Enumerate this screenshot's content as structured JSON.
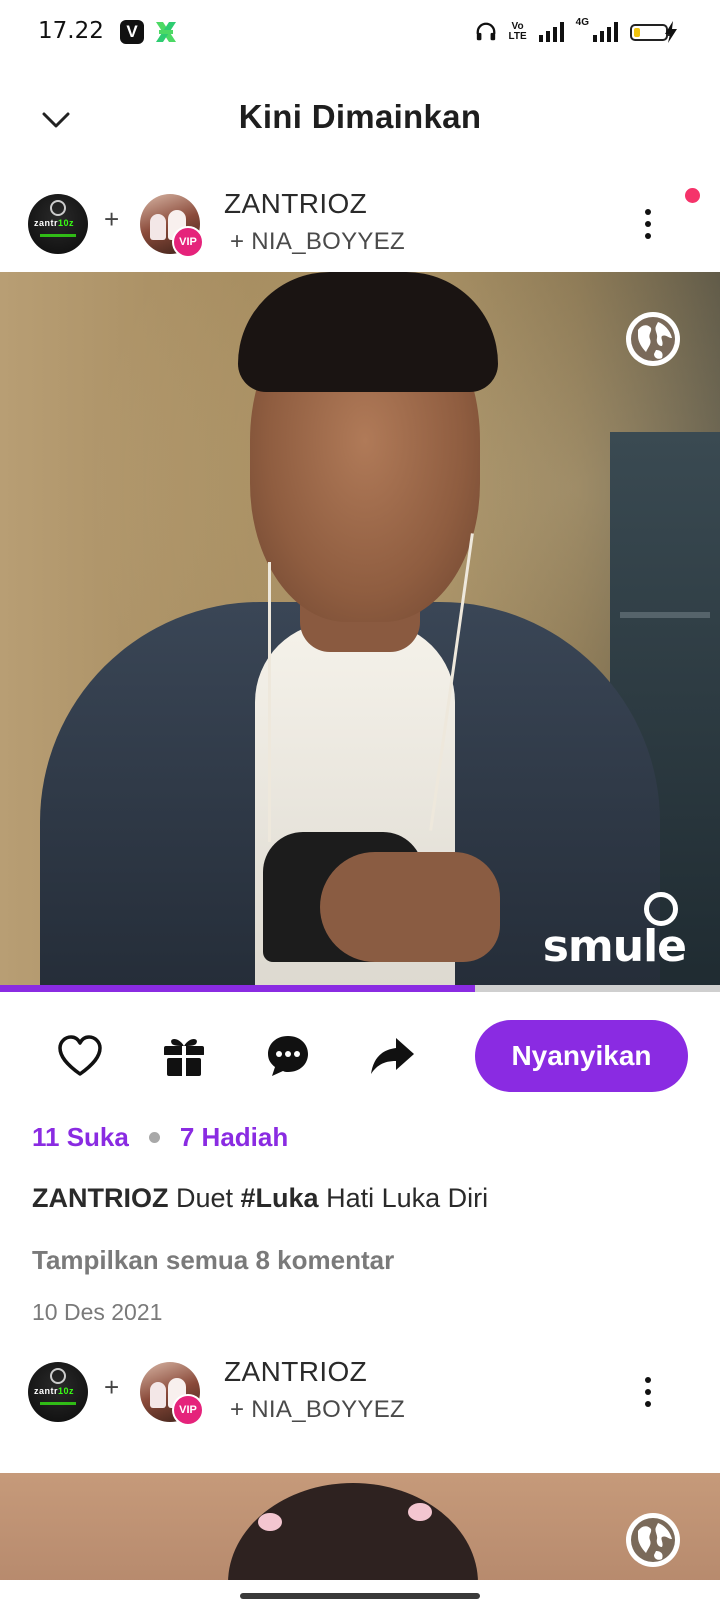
{
  "status_bar": {
    "time": "17.22",
    "app_icon_v": "V",
    "volte_top": "Vo",
    "volte_bottom": "LTE",
    "network": "4G",
    "battery_level": 0.2,
    "icons": [
      "headphones-icon",
      "signal-icon",
      "battery-icon",
      "charging-icon"
    ]
  },
  "header": {
    "title": "Kini Dimainkan",
    "back_icon": "chevron-down-icon"
  },
  "post1": {
    "owner": "ZANTRIOZ",
    "partner": "+ NIA_BOYYEZ",
    "vip_badge": "VIP",
    "avatar1_text": "zantr",
    "avatar1_highlight": "10z",
    "watermark": "smule",
    "progress": 0.66,
    "sing_label": "Nyanyikan",
    "likes": "11 Suka",
    "gifts": "7 Hadiah",
    "caption_user": "ZANTRIOZ",
    "caption_mid": " Duet ",
    "caption_tag": "#Luka",
    "caption_rest": " Hati Luka Diri",
    "comments_link": "Tampilkan semua 8 komentar",
    "date": "10 Des 2021"
  },
  "post2": {
    "owner": "ZANTRIOZ",
    "partner": "+ NIA_BOYYEZ",
    "vip_badge": "VIP",
    "avatar1_text": "zantr",
    "avatar1_highlight": "10z"
  },
  "colors": {
    "accent": "#8a2be2",
    "vip": "#e5237b",
    "notification": "#f5336a"
  }
}
